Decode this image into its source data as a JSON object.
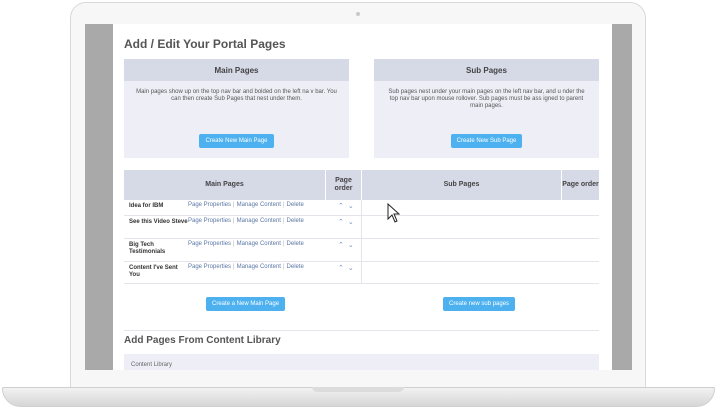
{
  "page": {
    "title": "Add / Edit Your Portal Pages"
  },
  "main_panel": {
    "header": "Main Pages",
    "description": "Main pages show up on the top nav bar and bolded on the left na v bar. You can then create Sub Pages that nest under them.",
    "button": "Create New Main Page"
  },
  "sub_panel": {
    "header": "Sub Pages",
    "description": "Sub pages nest under your main pages on the left nav bar, and u nder the top nav bar upon mouse rollover. Sub pages must be ass igned to parent main pages.",
    "button": "Create New Sub Page"
  },
  "table": {
    "headers": {
      "main_pages": "Main Pages",
      "page_order": "Page order",
      "sub_pages": "Sub Pages",
      "sub_page_order": "Page order"
    },
    "link_labels": {
      "properties": "Page Properties",
      "manage": "Manage Content",
      "delete": "Delete"
    },
    "rows": [
      {
        "name": "Idea for IBM"
      },
      {
        "name": "See this Video Steve"
      },
      {
        "name": "Big Tech Testimonials"
      },
      {
        "name": "Content I've Sent You"
      }
    ],
    "create_main_button": "Create a New Main Page",
    "create_sub_button": "Create new sub pages"
  },
  "library": {
    "title": "Add Pages From Content Library",
    "label": "Content Library"
  },
  "icons": {
    "up": "chevron-up-icon",
    "down": "chevron-down-icon",
    "cursor": "mouse-pointer-icon"
  },
  "colors": {
    "button": "#4db1ef",
    "header_bg": "#d6d9e6",
    "panel_bg": "#eeeff6",
    "link": "#5b77a5"
  }
}
